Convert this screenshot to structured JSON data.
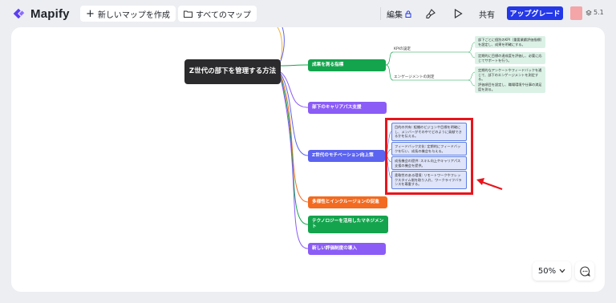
{
  "app": {
    "name": "Mapify"
  },
  "toolbar": {
    "new_map": "新しいマップを作成",
    "all_maps": "すべてのマップ",
    "edit": "編集",
    "share": "共有",
    "upgrade": "アップグレード",
    "version": "5.1"
  },
  "map": {
    "root": "Z世代の部下を管理する方法",
    "branches": [
      {
        "label": "成果を測る指標",
        "color": "#14a44d",
        "subs": [
          {
            "label": "KPIの設定",
            "leaves": [
              "部下ごとに個別のKPI（重要業績評価指標）を設定し、成果を明確にする。",
              "定期的に目標の達成度を評価し、必要に応じてサポートを行う。"
            ]
          },
          {
            "label": "エンゲージメントの測定",
            "leaves": [
              "定期的なアンケートやフィードバックを通じて、部下のエンゲージメントを測定する。",
              "評価項目を設定し、職場環境や仕事の満足度を測る。"
            ]
          }
        ]
      },
      {
        "label": "部下のキャリアパス支援",
        "color": "#8b5cf6"
      },
      {
        "label": "Z世代のモチベーション向上策",
        "color": "#5b63f0",
        "leaves": [
          "目的の共有: 組織のビジョンや目標を明確にし、メンバーがその中でどのように貢献できるかを伝える。",
          "フィードバック文化: 定期的にフィードバックを行い、成長の機会を与える。",
          "成長機会の提供: スキル向上やキャリアパス支援の機会を提供。",
          "柔軟性のある環境: リモートワークやフレックスタイム制を取り入れ、ワークライフバランスを尊重する。"
        ]
      },
      {
        "label": "多様性とインクルージョンの促進",
        "color": "#f26b21"
      },
      {
        "label": "テクノロジーを活用したマネジメント",
        "color": "#14a44d"
      },
      {
        "label": "新しい評価制度の導入",
        "color": "#8b5cf6"
      }
    ]
  },
  "zoom": {
    "level": "50%"
  },
  "icons": [
    "mapify-logo-icon",
    "plus-icon",
    "folder-icon",
    "lock-icon",
    "brush-icon",
    "play-icon",
    "layers-icon",
    "chevron-down-icon",
    "chat-icon",
    "red-arrow-icon"
  ],
  "colors": {
    "accent": "#2438e8",
    "highlight": "#e8141c",
    "leaf_green": "#dbf1e6",
    "leaf_blue": "#dfe4fa"
  }
}
